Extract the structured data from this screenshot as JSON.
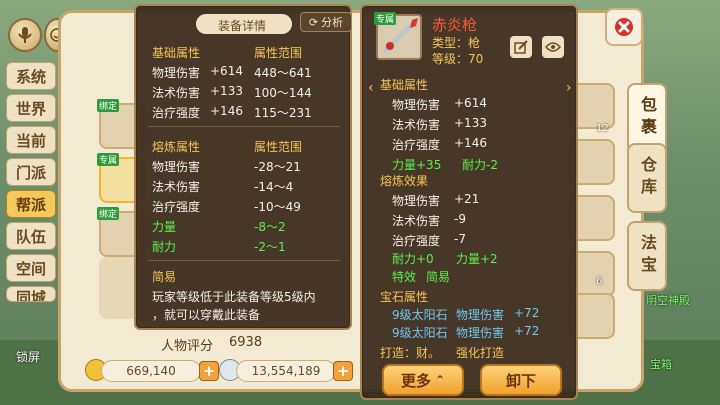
{
  "chat_tabs": [
    "系统",
    "世界",
    "当前",
    "门派",
    "帮派",
    "队伍",
    "空间",
    "同城"
  ],
  "chat_active_index": 4,
  "lock_label": "锁屏",
  "side_tabs": [
    "包裹",
    "仓库",
    "法宝"
  ],
  "item_badges": {
    "bound": "绑定",
    "exclusive": "专属"
  },
  "rating": {
    "label": "人物评分",
    "value": "6938"
  },
  "currency": {
    "gold": "669,140",
    "silver": "13,554,189"
  },
  "slot_counts": [
    "12",
    "6"
  ],
  "scene_text": [
    "明空神殿",
    "宝箱"
  ],
  "compare_tip": {
    "title": "装备详情",
    "analyze_label": "分析",
    "base_header": "基础属性",
    "range_header": "属性范围",
    "base_rows": [
      {
        "name": "物理伤害",
        "value": "+614",
        "range": "448～641"
      },
      {
        "name": "法术伤害",
        "value": "+133",
        "range": "100～144"
      },
      {
        "name": "治疗强度",
        "value": "+146",
        "range": "115～231"
      }
    ],
    "refine_header": "熔炼属性",
    "refine_range_header": "属性范围",
    "refine_rows": [
      {
        "name": "物理伤害",
        "range": "-28～21",
        "color": "white"
      },
      {
        "name": "法术伤害",
        "range": "-14～4",
        "color": "white"
      },
      {
        "name": "治疗强度",
        "range": "-10～49",
        "color": "white"
      },
      {
        "name": "力量",
        "range": "-8～2",
        "color": "green"
      },
      {
        "name": "耐力",
        "range": "-2～1",
        "color": "green"
      }
    ],
    "mode_label": "简易",
    "desc": "玩家等级低于此装备等级5级内，就可以穿戴此装备",
    "desc_line1": "玩家等级低于此装备等级5级内",
    "desc_line2": "，就可以穿戴此装备"
  },
  "item_tip": {
    "name": "赤炎枪",
    "badge": "专属",
    "type_line": "类型：枪",
    "level_line": "等级：70",
    "base_header": "基础属性",
    "base_rows": [
      {
        "name": "物理伤害",
        "value": "+614"
      },
      {
        "name": "法术伤害",
        "value": "+133"
      },
      {
        "name": "治疗强度",
        "value": "+146"
      }
    ],
    "stat_a": "力量+35",
    "stat_b": "耐力-2",
    "refine_header": "熔炼效果",
    "refine_rows": [
      {
        "name": "物理伤害",
        "value": "+21"
      },
      {
        "name": "法术伤害",
        "value": "-9"
      },
      {
        "name": "治疗强度",
        "value": "-7"
      }
    ],
    "refine_stat_a": "耐力+0",
    "refine_stat_b": "力量+2",
    "special_label": "特效",
    "special_value": "简易",
    "gem_header": "宝石属性",
    "gem_rows": [
      {
        "gem": "9级太阳石",
        "attr": "物理伤害",
        "value": "+72"
      },
      {
        "gem": "9级太阳石",
        "attr": "物理伤害",
        "value": "+72"
      }
    ],
    "forge_label": "打造：财。",
    "forge_action": "强化打造",
    "more_button": "更多",
    "unequip_button": "卸下"
  },
  "colors": {
    "gold": "#f7c557",
    "green": "#5df04a",
    "blue": "#6fc6f0",
    "panel": "#3a2c1e"
  }
}
